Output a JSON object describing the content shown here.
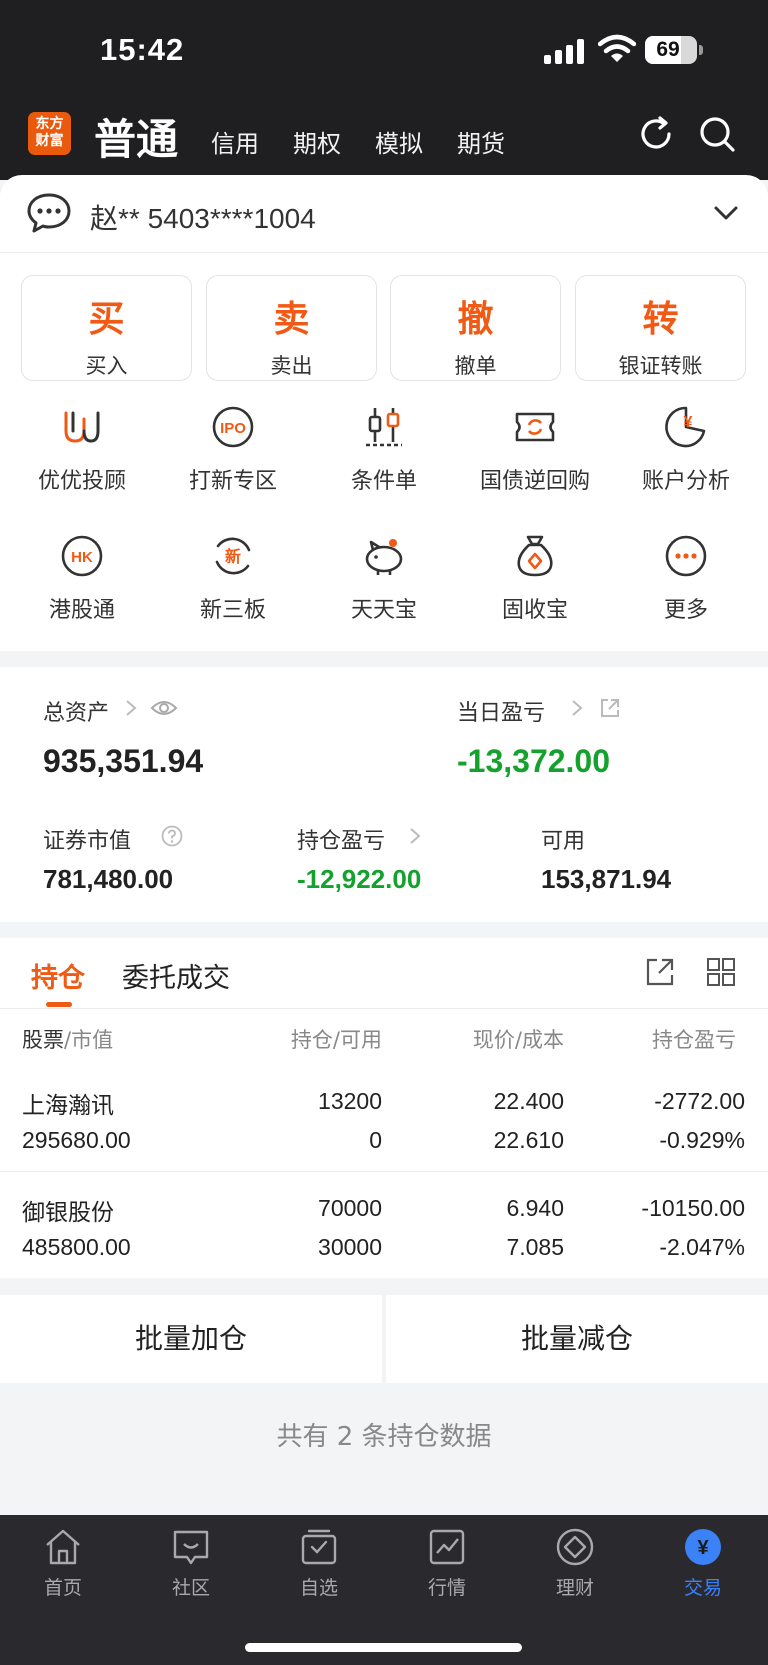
{
  "status_bar": {
    "time": "15:42",
    "battery": "69",
    "battery_level": 0.69
  },
  "header": {
    "logo_text": "东方财富",
    "tabs": [
      {
        "label": "普通",
        "active": true
      },
      {
        "label": "信用"
      },
      {
        "label": "期权"
      },
      {
        "label": "模拟"
      },
      {
        "label": "期货"
      }
    ],
    "icons": [
      "refresh-icon",
      "search-icon"
    ]
  },
  "account": {
    "text": "赵** 5403****1004"
  },
  "trade_buttons": [
    {
      "char": "买",
      "label": "买入"
    },
    {
      "char": "卖",
      "label": "卖出"
    },
    {
      "char": "撤",
      "label": "撤单"
    },
    {
      "char": "转",
      "label": "银证转账"
    }
  ],
  "grid": [
    {
      "label": "优优投顾",
      "icon": "youyou-icon"
    },
    {
      "label": "打新专区",
      "icon": "ipo-icon",
      "icon_text": "IPO"
    },
    {
      "label": "条件单",
      "icon": "conditional-order-icon"
    },
    {
      "label": "国债逆回购",
      "icon": "repo-icon"
    },
    {
      "label": "账户分析",
      "icon": "account-analysis-icon",
      "icon_text": "¥"
    },
    {
      "label": "港股通",
      "icon": "hk-icon",
      "icon_text": "HK"
    },
    {
      "label": "新三板",
      "icon": "new-third-board-icon",
      "icon_text": "新"
    },
    {
      "label": "天天宝",
      "icon": "piggy-bank-icon"
    },
    {
      "label": "固收宝",
      "icon": "money-bag-icon"
    },
    {
      "label": "更多",
      "icon": "more-icon"
    }
  ],
  "assets": {
    "total_label": "总资产",
    "total_value": "935,351.94",
    "daily_label": "当日盈亏",
    "daily_value": "-13,372.00",
    "market_label": "证券市值",
    "market_value": "781,480.00",
    "position_pl_label": "持仓盈亏",
    "position_pl_value": "-12,922.00",
    "available_label": "可用",
    "available_value": "153,871.94"
  },
  "holdings": {
    "tabs": [
      "持仓",
      "委托成交"
    ],
    "columns": {
      "c1a": "股票",
      "c1b": "市值",
      "c2a": "持仓",
      "c2b": "可用",
      "c3a": "现价",
      "c3b": "成本",
      "c4": "持仓盈亏"
    },
    "rows": [
      {
        "name": "上海瀚讯",
        "market_value": "295680.00",
        "position": "13200",
        "available": "0",
        "price": "22.400",
        "cost": "22.610",
        "pl": "-2772.00",
        "pl_pct": "-0.929%"
      },
      {
        "name": "御银股份",
        "market_value": "485800.00",
        "position": "70000",
        "available": "30000",
        "price": "6.940",
        "cost": "7.085",
        "pl": "-10150.00",
        "pl_pct": "-2.047%"
      }
    ]
  },
  "batch": {
    "add": "批量加仓",
    "reduce": "批量减仓"
  },
  "summary": "共有 2 条持仓数据",
  "tabbar": [
    {
      "label": "首页",
      "icon": "home-icon"
    },
    {
      "label": "社区",
      "icon": "community-icon"
    },
    {
      "label": "自选",
      "icon": "watchlist-icon"
    },
    {
      "label": "行情",
      "icon": "market-icon"
    },
    {
      "label": "理财",
      "icon": "wealth-icon"
    },
    {
      "label": "交易",
      "icon": "trade-icon",
      "active": true,
      "icon_text": "¥"
    }
  ],
  "colors": {
    "accent": "#f05a14",
    "down": "#14a12d",
    "tab_active": "#3b82f6",
    "header_bg": "#1f1f22"
  }
}
